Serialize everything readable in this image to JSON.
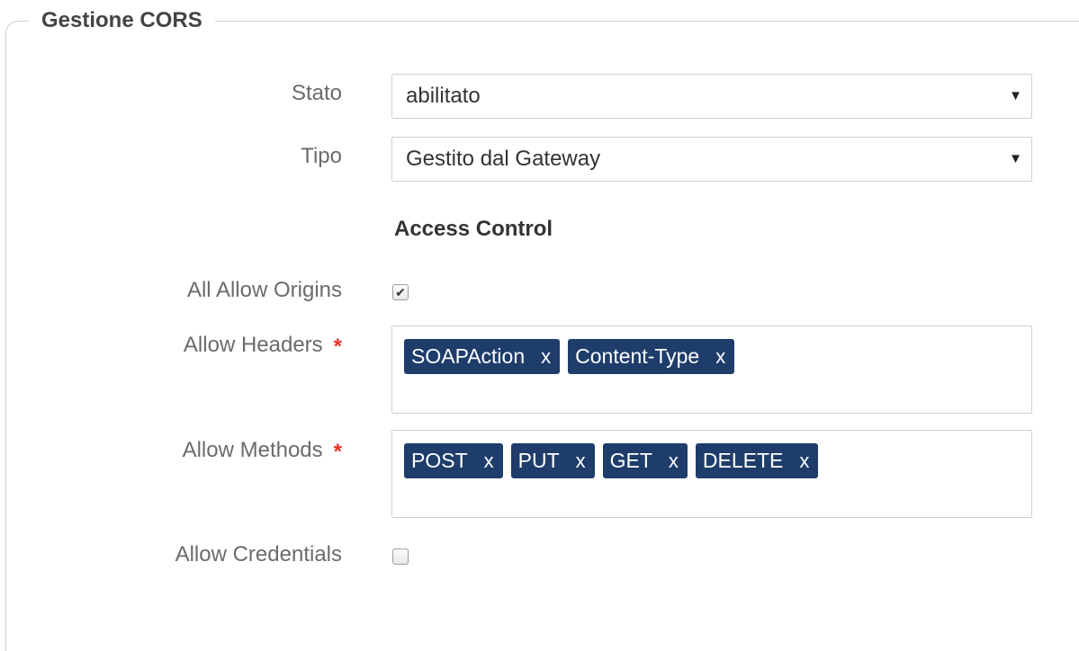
{
  "section": {
    "title": "Gestione CORS"
  },
  "stato": {
    "label": "Stato",
    "value": "abilitato"
  },
  "tipo": {
    "label": "Tipo",
    "value": "Gestito dal Gateway"
  },
  "access_control": {
    "title": "Access Control"
  },
  "all_allow_origins": {
    "label": "All Allow Origins",
    "checked": true,
    "check_glyph": "✔"
  },
  "allow_headers": {
    "label": "Allow Headers",
    "required_mark": "*",
    "tags": [
      "SOAPAction",
      "Content-Type"
    ]
  },
  "allow_methods": {
    "label": "Allow Methods",
    "required_mark": "*",
    "tags": [
      "POST",
      "PUT",
      "GET",
      "DELETE"
    ]
  },
  "allow_credentials": {
    "label": "Allow Credentials",
    "checked": false
  },
  "tag_remove_label": "x",
  "select_caret": "▼",
  "colors": {
    "tag_bg": "#1f3d6b",
    "required": "#e8332a"
  }
}
